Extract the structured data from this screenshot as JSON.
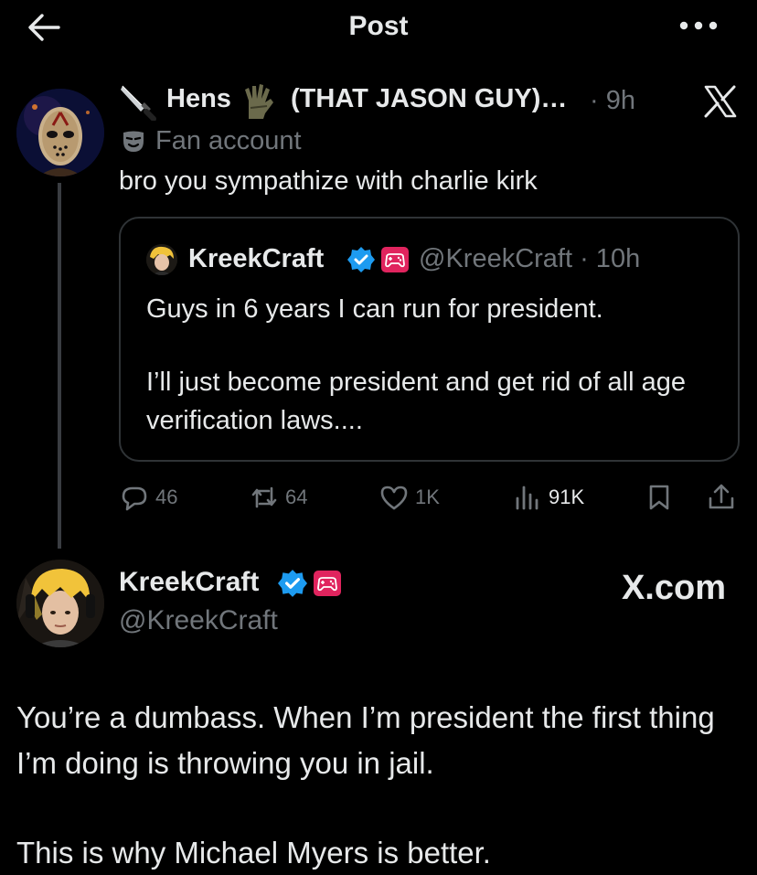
{
  "header": {
    "title": "Post",
    "back_icon": "arrow-left-icon",
    "more_icon": "more-horizontal-icon"
  },
  "post": {
    "name_part1": "Hens",
    "name_part2": "(THAT JASON GUY)…",
    "time": "· 9h",
    "label": "Fan account",
    "body": "bro you sympathize with charlie kirk",
    "icons": [
      "dagger-icon",
      "hand-icon",
      "mask-icon",
      "x-logo-icon"
    ]
  },
  "quote": {
    "name": "KreekCraft",
    "handle": "@KreekCraft · 10h",
    "lines": [
      "Guys in 6 years I can run for president.",
      "",
      "I’ll just become president and get rid of all age verification laws...."
    ]
  },
  "actions": {
    "replies": "46",
    "reposts": "64",
    "likes": "1K",
    "views": "91K"
  },
  "reply": {
    "name": "KreekCraft",
    "handle": "@KreekCraft",
    "brand": "X.com",
    "body_lines": [
      "You’re a dumbass. When I’m president the first thing I’m doing is throwing you in jail.",
      "",
      "This is why Michael Myers is better."
    ]
  },
  "colors": {
    "background": "#000000",
    "text": "#e7e9ea",
    "muted": "#71767b",
    "border": "#2f3336",
    "verified": "#1d9bf0",
    "game_badge": "#e0245e"
  }
}
